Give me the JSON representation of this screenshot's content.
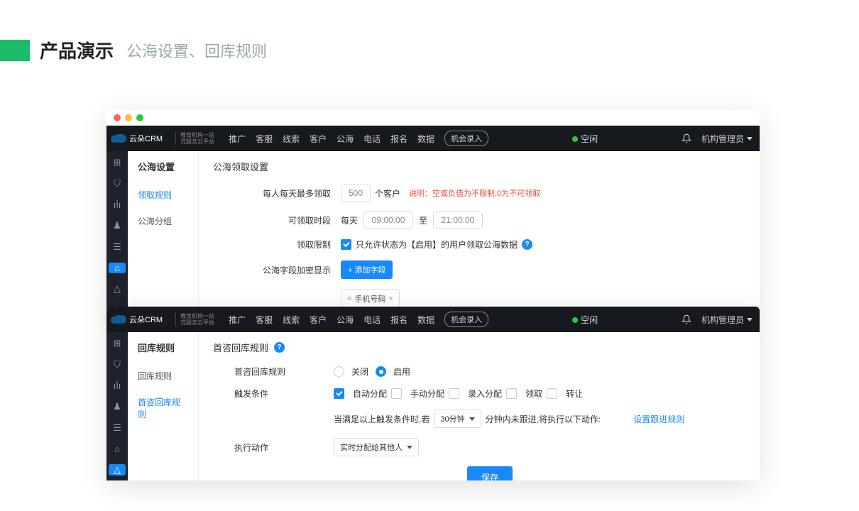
{
  "slide": {
    "title": "产品演示",
    "subtitle": "公海设置、回库规则"
  },
  "brand": {
    "name": "云朵CRM",
    "sub1": "教育机构一站",
    "sub2": "式服务云平台"
  },
  "nav": [
    "推广",
    "客服",
    "线索",
    "客户",
    "公海",
    "电话",
    "报名",
    "数据"
  ],
  "pill": "机会录入",
  "status": "空闲",
  "user": "机构管理员",
  "win1": {
    "sideTitle": "公海设置",
    "sideItems": [
      "领取规则",
      "公海分组"
    ],
    "sectionTitle": "公海领取设置",
    "rows": {
      "limitLabel": "每人每天最多领取",
      "limitValue": "500",
      "unit": "个客户",
      "tip": "说明：空或负值为不限制,0为不可领取",
      "timeLabel": "可领取时段",
      "daily": "每天",
      "time1": "09:00:00",
      "to": "至",
      "time2": "21:00:00",
      "restrictLabel": "领取限制",
      "restrictText": "只允许状态为【启用】的用户领取公海数据",
      "encryptLabel": "公海字段加密显示",
      "addBtn": "+ 添加字段",
      "tagPrefix": "≡",
      "tagText": "手机号码"
    }
  },
  "win2": {
    "sideTitle": "回库规则",
    "sideItems": [
      "回库规则",
      "首咨回库规则"
    ],
    "sectionTitle": "首咨回库规则",
    "rows": {
      "ruleLabel": "首咨回库规则",
      "off": "关闭",
      "on": "启用",
      "triggerLabel": "触发条件",
      "opts": [
        "自动分配",
        "手动分配",
        "录入分配",
        "领取",
        "转让"
      ],
      "condPrefix": "当满足以上触发条件时,若",
      "condTime": "30分钟",
      "condMid": "分钟内未跟进,将执行以下动作:",
      "followLink": "设置跟进规则",
      "actionLabel": "执行动作",
      "actionSelect": "实时分配给其他人",
      "save": "保存"
    }
  }
}
